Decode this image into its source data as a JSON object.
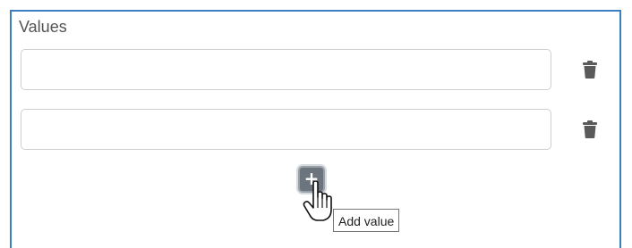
{
  "values_section": {
    "label": "Values",
    "inputs": [
      {
        "value": "",
        "placeholder": ""
      },
      {
        "value": "",
        "placeholder": ""
      }
    ],
    "delete_icon": "trash-icon",
    "add_button": {
      "symbol": "+",
      "tooltip": "Add value"
    }
  },
  "colors": {
    "frame_border": "#3b7ec2",
    "add_button_bg": "#6c757d",
    "trash_icon": "#5a5a5a"
  }
}
